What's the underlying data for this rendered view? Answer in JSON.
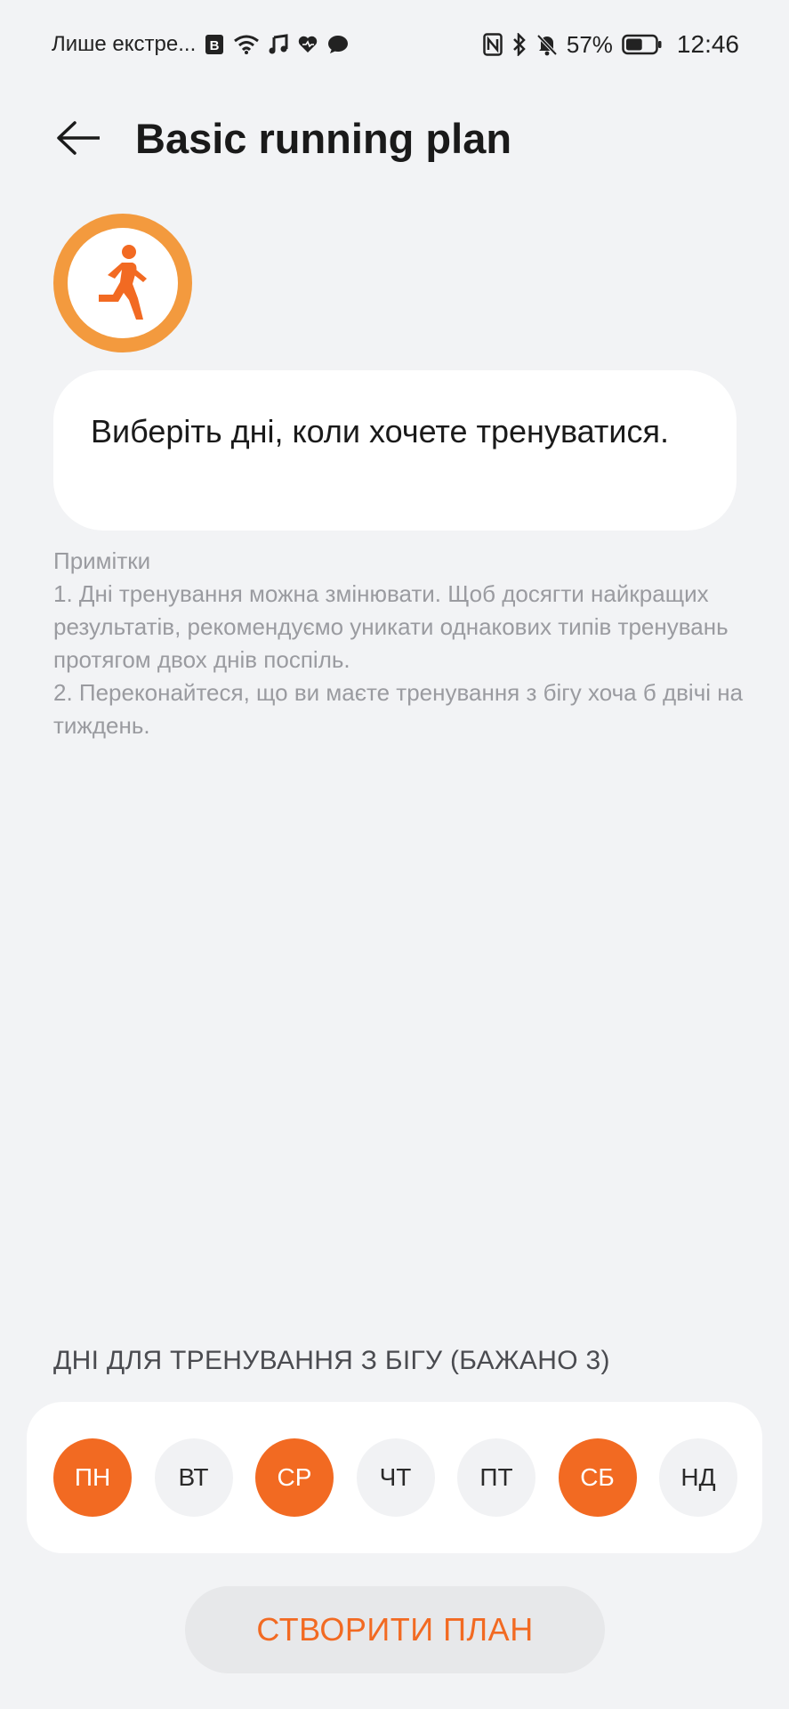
{
  "status_bar": {
    "carrier": "Лише екстре...",
    "battery_percent": "57%",
    "battery_level": 0.57,
    "time": "12:46",
    "icons_left": [
      "notification-b-icon",
      "wifi-icon",
      "music-icon",
      "heart-icon",
      "message-icon"
    ],
    "icons_right": [
      "nfc-icon",
      "bluetooth-icon",
      "mute-icon",
      "battery-icon"
    ]
  },
  "header": {
    "title": "Basic running plan"
  },
  "prompt": {
    "text": "Виберіть дні, коли хочете тренуватися."
  },
  "notes": {
    "title": "Примітки",
    "items": [
      "1. Дні тренування можна змінювати. Щоб досягти найкращих результатів, рекомендуємо уникати однакових типів тренувань протягом двох днів поспіль.",
      "2. Переконайтеся, що ви маєте тренування з бігу хоча б двічі на тиждень."
    ]
  },
  "days": {
    "heading": "ДНІ ДЛЯ ТРЕНУВАННЯ З БІГУ (БАЖАНО 3)",
    "items": [
      {
        "label": "ПН",
        "selected": true
      },
      {
        "label": "ВТ",
        "selected": false
      },
      {
        "label": "СР",
        "selected": true
      },
      {
        "label": "ЧТ",
        "selected": false
      },
      {
        "label": "ПТ",
        "selected": false
      },
      {
        "label": "СБ",
        "selected": true
      },
      {
        "label": "НД",
        "selected": false
      }
    ]
  },
  "create_button": {
    "label": "СТВОРИТИ ПЛАН"
  },
  "colors": {
    "accent": "#f26a22",
    "badge_ring": "#f39a3e",
    "background": "#f2f3f5"
  }
}
